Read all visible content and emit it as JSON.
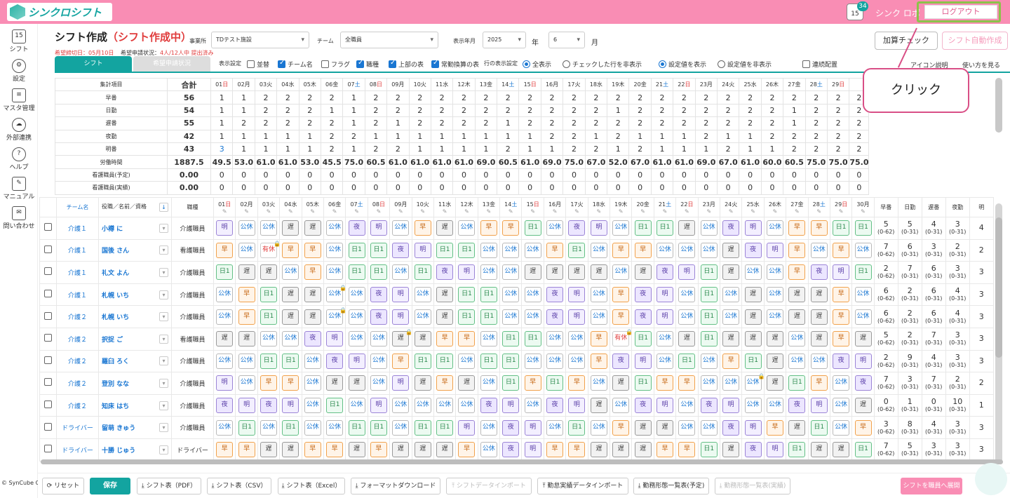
{
  "app": {
    "logo_text": "シンクロシフト",
    "notif_icon_text": "15",
    "notif_count": "34",
    "user_name": "シンク ロボ",
    "logout_label": "ログアウト"
  },
  "sidebar": [
    {
      "label": "シフト",
      "icon": "calendar-icon",
      "glyph": "15"
    },
    {
      "label": "設定",
      "icon": "gear-icon",
      "glyph": "⚙"
    },
    {
      "label": "マスタ管理",
      "icon": "database-icon",
      "glyph": "≡"
    },
    {
      "label": "外部連携",
      "icon": "cloud-sync-icon",
      "glyph": "☁"
    },
    {
      "label": "ヘルプ",
      "icon": "help-icon",
      "glyph": "?"
    },
    {
      "label": "マニュアル",
      "icon": "manual-icon",
      "glyph": "✎"
    },
    {
      "label": "問い合わせ",
      "icon": "mail-icon",
      "glyph": "✉"
    }
  ],
  "copyright": "© SynCube Co., Ltd.",
  "header": {
    "title": "シフト作成",
    "status": "（シフト作成中）",
    "deadline": "希望締切日：05月10日",
    "request_status_label": "希望申請状況：",
    "request_status": "4人/12人中 提出済み",
    "office_label": "事業所",
    "office_value": "TDテスト施設",
    "team_label": "チーム",
    "team_value": "全職員",
    "month_label": "表示年月",
    "year_value": "2025",
    "year_unit": "年",
    "month_value": "6",
    "month_unit": "月",
    "kasan_label": "加算チェック",
    "auto_label": "シフト自動作成"
  },
  "tabs": {
    "shift": "シフト",
    "request": "希望申請状況"
  },
  "display": {
    "settings_label": "表示設定",
    "opt_sort": "並替",
    "opt_team": "チーム名",
    "opt_flag": "フラグ",
    "opt_job": "職種",
    "opt_upper": "上部の表",
    "opt_fulltime": "常勤換算の表",
    "row_label": "行の表示設定",
    "row_all": "全表示",
    "row_hide_checked": "チェックした行を非表示",
    "show_setting": "設定値を表示",
    "hide_setting": "設定値を非表示",
    "consecutive": "連続配置",
    "icon_link": "アイコン説明",
    "howto": "使い方を見る"
  },
  "callout": "クリック",
  "days": [
    {
      "d": "01",
      "w": "日",
      "c": "sun"
    },
    {
      "d": "02",
      "w": "月",
      "c": ""
    },
    {
      "d": "03",
      "w": "火",
      "c": ""
    },
    {
      "d": "04",
      "w": "水",
      "c": ""
    },
    {
      "d": "05",
      "w": "木",
      "c": ""
    },
    {
      "d": "06",
      "w": "金",
      "c": ""
    },
    {
      "d": "07",
      "w": "土",
      "c": "sat"
    },
    {
      "d": "08",
      "w": "日",
      "c": "sun"
    },
    {
      "d": "09",
      "w": "月",
      "c": ""
    },
    {
      "d": "10",
      "w": "火",
      "c": ""
    },
    {
      "d": "11",
      "w": "水",
      "c": ""
    },
    {
      "d": "12",
      "w": "木",
      "c": ""
    },
    {
      "d": "13",
      "w": "金",
      "c": ""
    },
    {
      "d": "14",
      "w": "土",
      "c": "sat"
    },
    {
      "d": "15",
      "w": "日",
      "c": "sun"
    },
    {
      "d": "16",
      "w": "月",
      "c": ""
    },
    {
      "d": "17",
      "w": "火",
      "c": ""
    },
    {
      "d": "18",
      "w": "水",
      "c": ""
    },
    {
      "d": "19",
      "w": "木",
      "c": ""
    },
    {
      "d": "20",
      "w": "金",
      "c": ""
    },
    {
      "d": "21",
      "w": "土",
      "c": "sat"
    },
    {
      "d": "22",
      "w": "日",
      "c": "sun"
    },
    {
      "d": "23",
      "w": "月",
      "c": ""
    },
    {
      "d": "24",
      "w": "火",
      "c": ""
    },
    {
      "d": "25",
      "w": "水",
      "c": ""
    },
    {
      "d": "26",
      "w": "木",
      "c": ""
    },
    {
      "d": "27",
      "w": "金",
      "c": ""
    },
    {
      "d": "28",
      "w": "土",
      "c": "sat"
    },
    {
      "d": "29",
      "w": "日",
      "c": "sun"
    }
  ],
  "summary": {
    "col_item": "集計項目",
    "col_total": "合計",
    "rows": [
      {
        "label": "早番",
        "total": "56",
        "vals": [
          "1",
          "1",
          "2",
          "2",
          "2",
          "2",
          "1",
          "2",
          "2",
          "2",
          "2",
          "2",
          "2",
          "2",
          "2",
          "2",
          "2",
          "2",
          "2",
          "2",
          "2",
          "2",
          "2",
          "2",
          "2",
          "2",
          "2",
          "2",
          "2",
          "2"
        ]
      },
      {
        "label": "日勤",
        "total": "54",
        "vals": [
          "1",
          "1",
          "2",
          "2",
          "2",
          "1",
          "1",
          "2",
          "2",
          "2",
          "2",
          "2",
          "2",
          "2",
          "2",
          "2",
          "2",
          "2",
          "1",
          "2",
          "2",
          "2",
          "2",
          "2",
          "2",
          "2",
          "1",
          "2",
          "2",
          "2"
        ]
      },
      {
        "label": "遅番",
        "total": "55",
        "vals": [
          "1",
          "2",
          "2",
          "2",
          "2",
          "2",
          "1",
          "2",
          "1",
          "2",
          "2",
          "2",
          "2",
          "1",
          "2",
          "2",
          "2",
          "2",
          "2",
          "2",
          "2",
          "2",
          "2",
          "2",
          "2",
          "2",
          "1",
          "2",
          "2",
          "2"
        ]
      },
      {
        "label": "夜勤",
        "total": "42",
        "vals": [
          "1",
          "1",
          "1",
          "1",
          "1",
          "2",
          "2",
          "1",
          "1",
          "1",
          "1",
          "1",
          "1",
          "1",
          "1",
          "2",
          "2",
          "1",
          "2",
          "1",
          "1",
          "1",
          "2",
          "1",
          "1",
          "2",
          "2",
          "2",
          "2",
          "2"
        ]
      },
      {
        "label": "明番",
        "total": "43",
        "vals": [
          "3",
          "1",
          "1",
          "1",
          "1",
          "2",
          "1",
          "2",
          "2",
          "1",
          "1",
          "1",
          "1",
          "2",
          "1",
          "1",
          "2",
          "2",
          "1",
          "2",
          "1",
          "1",
          "1",
          "2",
          "1",
          "1",
          "2",
          "2",
          "2",
          "2"
        ]
      },
      {
        "label": "労働時間",
        "total": "1887.5",
        "vals": [
          "49.5",
          "53.0",
          "61.0",
          "61.0",
          "53.0",
          "45.5",
          "75.0",
          "60.5",
          "61.0",
          "61.0",
          "61.0",
          "61.0",
          "69.0",
          "60.5",
          "61.0",
          "69.0",
          "75.0",
          "67.0",
          "52.0",
          "67.0",
          "61.0",
          "61.0",
          "69.0",
          "67.0",
          "61.0",
          "60.0",
          "60.5",
          "75.0",
          "75.0",
          "75.0"
        ]
      },
      {
        "label": "看護職員(予定)",
        "total": "0.00",
        "vals": [
          "0",
          "0",
          "0",
          "0",
          "0",
          "0",
          "0",
          "0",
          "0",
          "0",
          "0",
          "0",
          "0",
          "0",
          "0",
          "0",
          "0",
          "0",
          "0",
          "0",
          "0",
          "0",
          "0",
          "0",
          "0",
          "0",
          "0",
          "0",
          "0",
          "0"
        ]
      },
      {
        "label": "看護職員(実績)",
        "total": "0.00",
        "vals": [
          "0",
          "0",
          "0",
          "0",
          "0",
          "0",
          "0",
          "0",
          "0",
          "0",
          "0",
          "0",
          "0",
          "0",
          "0",
          "0",
          "0",
          "0",
          "0",
          "0",
          "0",
          "0",
          "0",
          "0",
          "0",
          "0",
          "0",
          "0",
          "0",
          "0"
        ]
      }
    ]
  },
  "grid": {
    "col_team": "チーム名",
    "col_name": "役職／名前／資格",
    "col_job": "職種",
    "sum_cols": [
      "早番",
      "日勤",
      "遅番",
      "夜勤",
      "明"
    ],
    "staff": [
      {
        "team": "介護１",
        "name": "小樽 に",
        "job": "介護職員",
        "shifts": [
          "明",
          "公休",
          "公休",
          "遅",
          "遅",
          "公休",
          "夜",
          "明",
          "公休",
          "早",
          "遅",
          "公休",
          "早",
          "早",
          "日1",
          "公休",
          "夜",
          "明",
          "公休",
          "日1",
          "日1",
          "遅",
          "公休",
          "夜",
          "明",
          "公休",
          "早",
          "早",
          "日1",
          "日1"
        ],
        "locks": [],
        "sums": [
          [
            "5",
            "(0-62)"
          ],
          [
            "5",
            "(0-31)"
          ],
          [
            "4",
            "(0-31)"
          ],
          [
            "3",
            "(0-31)"
          ],
          [
            "4",
            ""
          ]
        ]
      },
      {
        "team": "介護１",
        "name": "国後 さん",
        "job": "看護職員",
        "shifts": [
          "早",
          "公休",
          "有休",
          "早",
          "早",
          "公休",
          "日1",
          "日1",
          "夜",
          "明",
          "日1",
          "日1",
          "公休",
          "公休",
          "公休",
          "早",
          "日1",
          "公休",
          "早",
          "早",
          "公休",
          "公休",
          "公休",
          "遅",
          "夜",
          "明",
          "早",
          "公休",
          "早",
          "公休"
        ],
        "locks": [
          2
        ],
        "sums": [
          [
            "7",
            "(0-62)"
          ],
          [
            "6",
            "(0-31)"
          ],
          [
            "3",
            "(0-31)"
          ],
          [
            "2",
            "(0-31)"
          ],
          [
            "2",
            ""
          ]
        ]
      },
      {
        "team": "介護１",
        "name": "礼文 よん",
        "job": "介護職員",
        "shifts": [
          "日1",
          "遅",
          "遅",
          "公休",
          "早",
          "公休",
          "日1",
          "日1",
          "公休",
          "日1",
          "夜",
          "明",
          "公休",
          "公休",
          "遅",
          "遅",
          "遅",
          "遅",
          "公休",
          "遅",
          "夜",
          "明",
          "日1",
          "遅",
          "公休",
          "公休",
          "早",
          "夜",
          "明",
          "日1"
        ],
        "locks": [],
        "sums": [
          [
            "2",
            "(0-62)"
          ],
          [
            "7",
            "(0-31)"
          ],
          [
            "6",
            "(0-31)"
          ],
          [
            "3",
            "(0-31)"
          ],
          [
            "3",
            ""
          ]
        ]
      },
      {
        "team": "介護１",
        "name": "札幌 いち",
        "job": "介護職員",
        "shifts": [
          "公休",
          "早",
          "日1",
          "遅",
          "遅",
          "公休",
          "公休",
          "夜",
          "明",
          "公休",
          "遅",
          "日1",
          "日1",
          "公休",
          "公休",
          "夜",
          "明",
          "公休",
          "早",
          "夜",
          "明",
          "公休",
          "日1",
          "公休",
          "遅",
          "公休",
          "遅",
          "遅",
          "早",
          "公休"
        ],
        "locks": [
          5
        ],
        "sums": [
          [
            "6",
            "(0-62)"
          ],
          [
            "2",
            "(0-31)"
          ],
          [
            "6",
            "(0-31)"
          ],
          [
            "4",
            "(0-31)"
          ],
          [
            "3",
            ""
          ]
        ]
      },
      {
        "team": "介護２",
        "name": "札幌 いち",
        "job": "介護職員",
        "shifts": [
          "公休",
          "早",
          "日1",
          "遅",
          "遅",
          "公休",
          "公休",
          "夜",
          "明",
          "公休",
          "遅",
          "日1",
          "日1",
          "公休",
          "公休",
          "夜",
          "明",
          "公休",
          "早",
          "夜",
          "明",
          "公休",
          "日1",
          "公休",
          "遅",
          "公休",
          "遅",
          "遅",
          "早",
          "公休"
        ],
        "locks": [
          5
        ],
        "sums": [
          [
            "6",
            "(0-62)"
          ],
          [
            "2",
            "(0-31)"
          ],
          [
            "6",
            "(0-31)"
          ],
          [
            "4",
            "(0-31)"
          ],
          [
            "3",
            ""
          ]
        ]
      },
      {
        "team": "介護２",
        "name": "択捉 ご",
        "job": "看護職員",
        "shifts": [
          "遅",
          "遅",
          "公休",
          "公休",
          "夜",
          "明",
          "公休",
          "公休",
          "遅",
          "遅",
          "早",
          "早",
          "公休",
          "日1",
          "日1",
          "公休",
          "公休",
          "早",
          "有休",
          "日1",
          "公休",
          "遅",
          "日1",
          "遅",
          "遅",
          "遅",
          "公休",
          "遅",
          "早",
          "遅"
        ],
        "locks": [
          8,
          18
        ],
        "sums": [
          [
            "5",
            "(0-62)"
          ],
          [
            "2",
            "(0-31)"
          ],
          [
            "7",
            "(0-31)"
          ],
          [
            "3",
            "(0-31)"
          ],
          [
            "3",
            ""
          ]
        ]
      },
      {
        "team": "介護２",
        "name": "羅臼 ろく",
        "job": "介護職員",
        "shifts": [
          "公休",
          "公休",
          "日1",
          "日1",
          "公休",
          "夜",
          "明",
          "公休",
          "早",
          "日1",
          "日1",
          "公休",
          "日1",
          "日1",
          "公休",
          "公休",
          "公休",
          "早",
          "夜",
          "明",
          "公休",
          "日1",
          "公休",
          "早",
          "日1",
          "遅",
          "公休",
          "公休",
          "夜",
          "明"
        ],
        "locks": [],
        "sums": [
          [
            "2",
            "(0-62)"
          ],
          [
            "9",
            "(0-31)"
          ],
          [
            "4",
            "(0-31)"
          ],
          [
            "3",
            "(0-31)"
          ],
          [
            "3",
            ""
          ]
        ]
      },
      {
        "team": "介護２",
        "name": "登別 なな",
        "job": "介護職員",
        "shifts": [
          "明",
          "公休",
          "早",
          "早",
          "公休",
          "遅",
          "遅",
          "公休",
          "明",
          "遅",
          "早",
          "遅",
          "公休",
          "日1",
          "早",
          "日1",
          "早",
          "公休",
          "遅",
          "日1",
          "早",
          "早",
          "公休",
          "公休",
          "公休",
          "遅",
          "日1",
          "早",
          "公休",
          "夜"
        ],
        "locks": [
          24
        ],
        "sums": [
          [
            "7",
            "(0-62)"
          ],
          [
            "3",
            "(0-31)"
          ],
          [
            "7",
            "(0-31)"
          ],
          [
            "2",
            "(0-31)"
          ],
          [
            "2",
            ""
          ]
        ]
      },
      {
        "team": "介護２",
        "name": "知床 はち",
        "job": "介護職員",
        "shifts": [
          "夜",
          "明",
          "夜",
          "明",
          "公休",
          "日1",
          "公休",
          "明",
          "公休",
          "公休",
          "公休",
          "公休",
          "夜",
          "明",
          "公休",
          "夜",
          "明",
          "遅",
          "公休",
          "夜",
          "明",
          "公休",
          "夜",
          "明",
          "公休",
          "公休",
          "夜",
          "明",
          "公休",
          "遅"
        ],
        "locks": [],
        "sums": [
          [
            "0",
            "(0-62)"
          ],
          [
            "1",
            "(0-31)"
          ],
          [
            "0",
            "(0-31)"
          ],
          [
            "10",
            "(0-31)"
          ],
          [
            "1",
            ""
          ]
        ]
      },
      {
        "team": "ドライバー",
        "name": "留萌 きゅう",
        "job": "介護職員",
        "shifts": [
          "公休",
          "日1",
          "公休",
          "日1",
          "公休",
          "公休",
          "日1",
          "日1",
          "公休",
          "日1",
          "日1",
          "明",
          "公休",
          "夜",
          "明",
          "公休",
          "日1",
          "公休",
          "早",
          "遅",
          "遅",
          "公休",
          "公休",
          "夜",
          "明",
          "早",
          "遅",
          "日1",
          "公休",
          "早"
        ],
        "locks": [],
        "sums": [
          [
            "3",
            "(0-62)"
          ],
          [
            "8",
            "(0-31)"
          ],
          [
            "4",
            "(0-31)"
          ],
          [
            "3",
            "(0-31)"
          ],
          [
            "3",
            ""
          ]
        ]
      },
      {
        "team": "ドライバー",
        "name": "十勝 じゅう",
        "job": "ドライバー",
        "shifts": [
          "早",
          "早",
          "遅",
          "遅",
          "早",
          "早",
          "遅",
          "早",
          "遅",
          "遅",
          "遅",
          "早",
          "公休",
          "夜",
          "明",
          "早",
          "早",
          "遅",
          "遅",
          "遅",
          "早",
          "早",
          "日1",
          "遅",
          "夜",
          "明",
          "日1",
          "遅",
          "遅",
          "日1"
        ],
        "locks": [],
        "sums": [
          [
            "7",
            "(0-62)"
          ],
          [
            "5",
            "(0-31)"
          ],
          [
            "3",
            "(0-31)"
          ],
          [
            "3",
            "(0-31)"
          ],
          [
            "3",
            ""
          ]
        ]
      }
    ]
  },
  "bottom": {
    "reset": "リセット",
    "save": "保存",
    "pdf": "シフト表（PDF）",
    "csv": "シフト表（CSV）",
    "excel": "シフト表（Excel）",
    "format_dl": "フォーマットダウンロード",
    "import": "シフトデータインポート",
    "attendance_import": "勤怠実績データインポート",
    "list_plan": "勤務形態一覧表(予定)",
    "list_actual": "勤務形態一覧表(実績)",
    "deploy": "シフトを職員へ展開"
  }
}
